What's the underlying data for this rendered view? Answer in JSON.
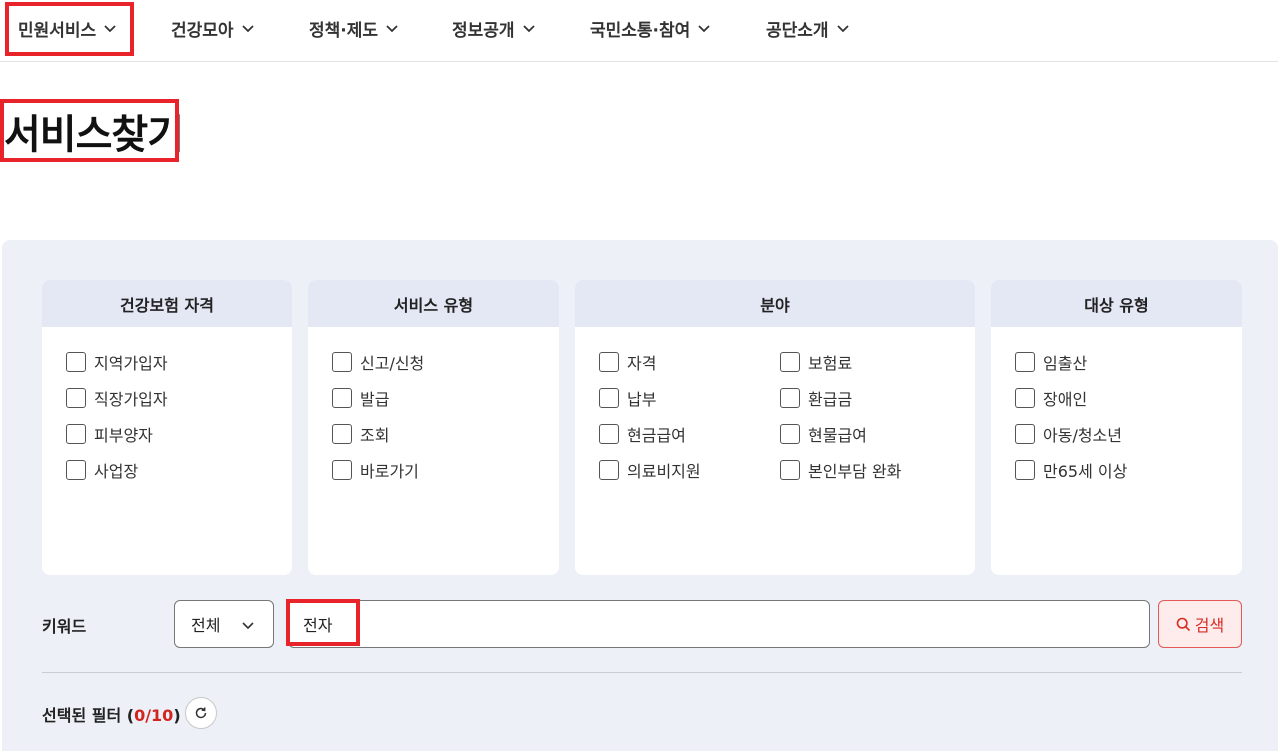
{
  "nav": {
    "items": [
      {
        "label": "민원서비스"
      },
      {
        "label": "건강모아"
      },
      {
        "label": "정책·제도"
      },
      {
        "label": "정보공개"
      },
      {
        "label": "국민소통·참여"
      },
      {
        "label": "공단소개"
      }
    ]
  },
  "page": {
    "title": "서비스찾기"
  },
  "filters": {
    "qualification": {
      "title": "건강보험 자격",
      "options": [
        "지역가입자",
        "직장가입자",
        "피부양자",
        "사업장"
      ]
    },
    "service_type": {
      "title": "서비스 유형",
      "options": [
        "신고/신청",
        "발급",
        "조회",
        "바로가기"
      ]
    },
    "field": {
      "title": "분야",
      "options": [
        "자격",
        "보험료",
        "납부",
        "환급금",
        "현금급여",
        "현물급여",
        "의료비지원",
        "본인부담 완화"
      ]
    },
    "target_type": {
      "title": "대상 유형",
      "options": [
        "임출산",
        "장애인",
        "아동/청소년",
        "만65세 이상"
      ]
    }
  },
  "search": {
    "label": "키워드",
    "scope_selected": "전체",
    "value": "전자",
    "button_label": "검색"
  },
  "selected_filters": {
    "label": "선택된 필터",
    "count": "0/10"
  },
  "colors": {
    "accent": "#d1261f",
    "highlight": "#e8232a",
    "panel_bg": "#edf0f6",
    "card_head_bg": "#e4e8f5"
  }
}
